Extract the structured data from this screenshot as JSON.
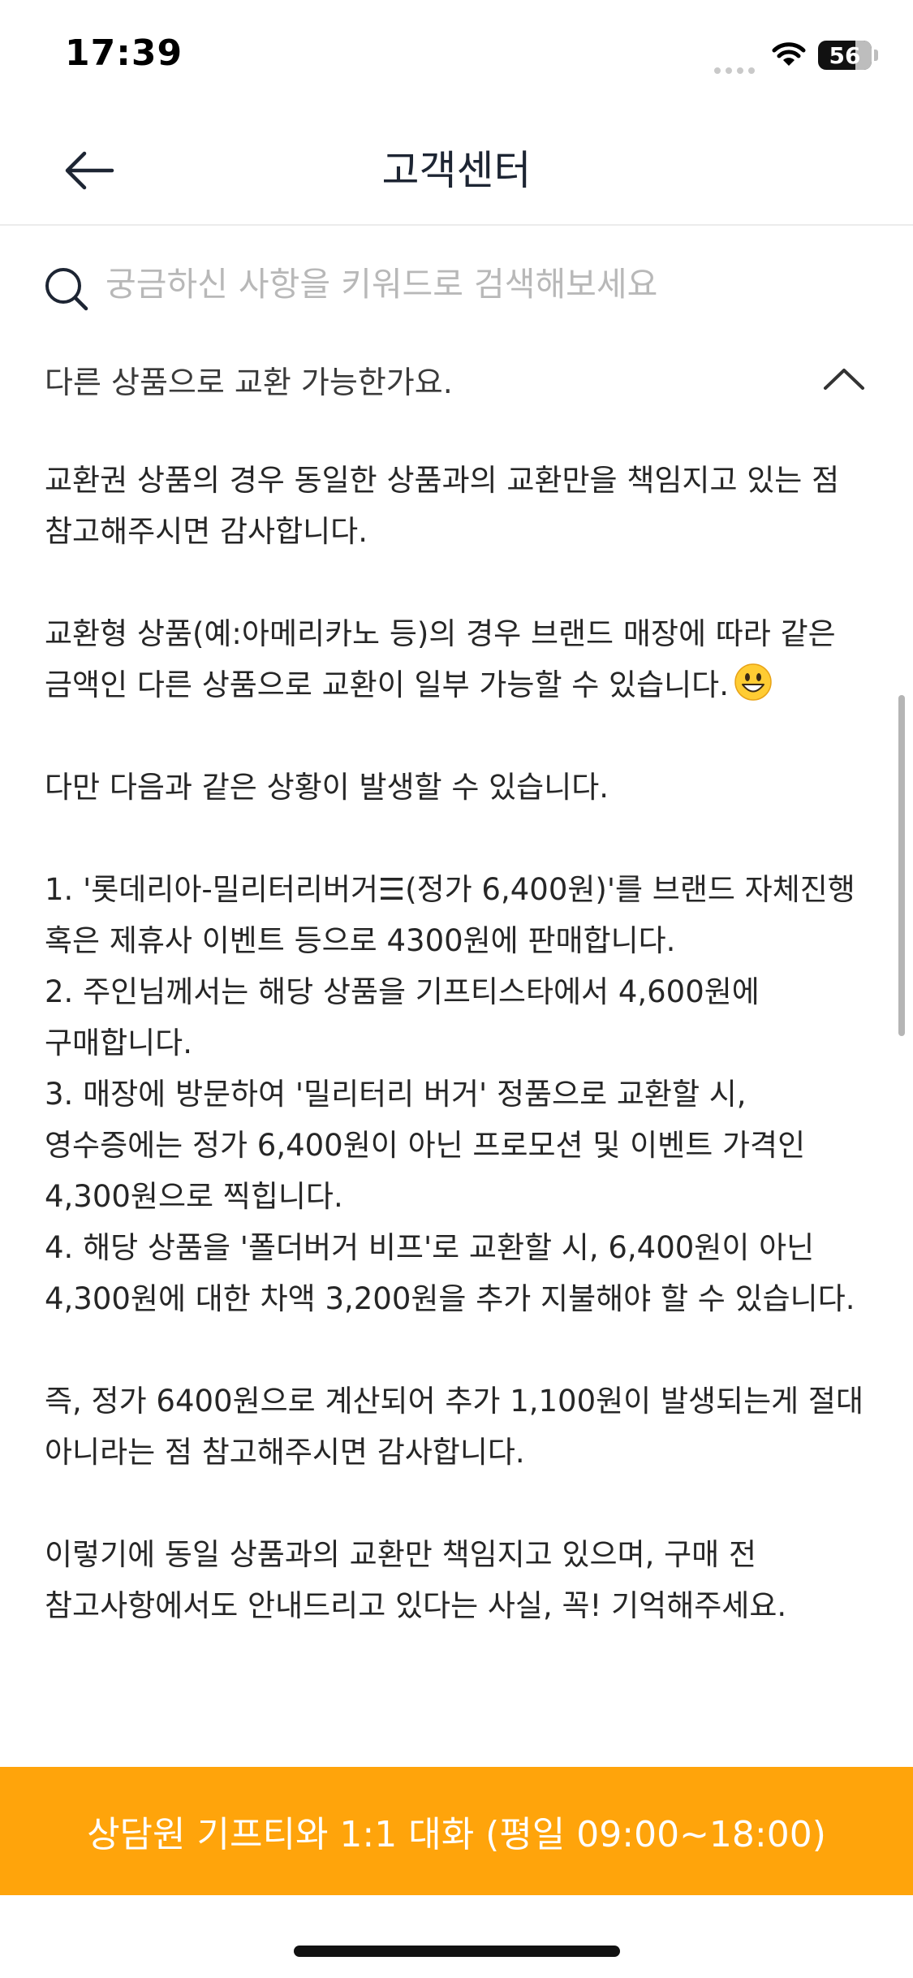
{
  "status_bar": {
    "time": "17:39",
    "battery": "56",
    "icons": [
      "signal-dots-icon",
      "wifi-icon",
      "battery-icon"
    ]
  },
  "header": {
    "title": "고객센터",
    "back_icon": "arrow-left-icon"
  },
  "search": {
    "placeholder": "궁금하신 사항을 키워드로 검색해보세요",
    "value": "",
    "icon": "search-icon"
  },
  "faq": {
    "question": "다른 상품으로 교환 가능한가요.",
    "expanded": true,
    "toggle_icon": "chevron-up-icon",
    "answer": {
      "p1": "교환권 상품의 경우 동일한 상품과의 교환만을 책임지고 있는 점 참고해주시면 감사합니다.",
      "p2": "교환형 상품(예:아메리카노 등)의 경우 브랜드 매장에 따라 같은 금액인 다른 상품으로 교환이 일부 가능할 수 있습니다.",
      "p2_emoji": "smiling-face-emoji",
      "p3": "다만 다음과 같은 상황이 발생할 수 있습니다.",
      "list": [
        "1. '롯데리아-밀리터리버거☰(정가 6,400원)'를 브랜드 자체진행 혹은 제휴사 이벤트 등으로 4300원에 판매합니다.",
        "2. 주인님께서는 해당 상품을 기프티스타에서 4,600원에 구매합니다.",
        "3. 매장에 방문하여 '밀리터리 버거' 정품으로 교환할 시, 영수증에는 정가 6,400원이 아닌 프로모션 및 이벤트 가격인 4,300원으로 찍힙니다.",
        "4. 해당 상품을 '폴더버거 비프'로 교환할 시, 6,400원이 아닌 4,300원에 대한 차액 3,200원을 추가 지불해야 할 수 있습니다."
      ],
      "p4": "즉, 정가 6400원으로 계산되어 추가 1,100원이 발생되는게 절대 아니라는 점 참고해주시면 감사합니다.",
      "p5": "이렇기에 동일 상품과의 교환만 책임지고 있으며, 구매 전 참고사항에서도 안내드리고 있다는 사실, 꼭! 기억해주세요."
    }
  },
  "cta": {
    "label": "상담원 기프티와 1:1 대화 (평일 09:00~18:00)",
    "color": "#ffa40b"
  }
}
